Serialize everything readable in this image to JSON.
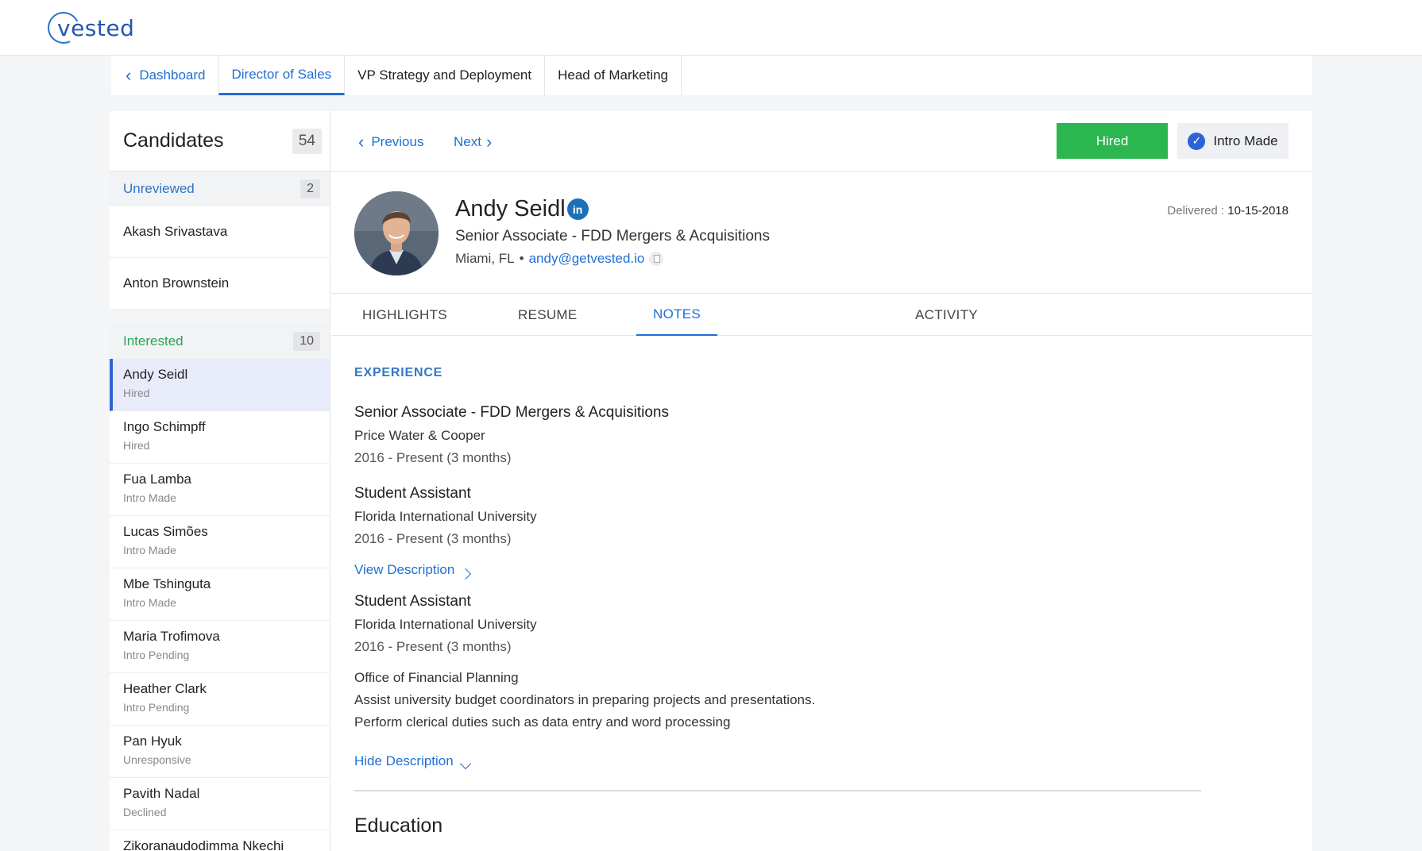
{
  "brand": {
    "logo_text": "vested"
  },
  "job_tabs": {
    "back_label": "Dashboard",
    "items": [
      "Director of Sales",
      "VP Strategy and Deployment",
      "Head of Marketing"
    ]
  },
  "sidebar": {
    "title": "Candidates",
    "total": "54",
    "groups": {
      "unreviewed": {
        "label": "Unreviewed",
        "count": "2",
        "items": [
          "Akash Srivastava",
          "Anton Brownstein"
        ]
      },
      "interested": {
        "label": "Interested",
        "count": "10",
        "items": [
          {
            "name": "Andy Seidl",
            "status": "Hired"
          },
          {
            "name": "Ingo Schimpff",
            "status": "Hired"
          },
          {
            "name": "Fua Lamba",
            "status": "Intro Made"
          },
          {
            "name": "Lucas Simões",
            "status": "Intro Made"
          },
          {
            "name": "Mbe Tshinguta",
            "status": "Intro Made"
          },
          {
            "name": "Maria Trofimova",
            "status": "Intro Pending"
          },
          {
            "name": "Heather Clark",
            "status": "Intro Pending"
          },
          {
            "name": "Pan Hyuk",
            "status": "Unresponsive"
          },
          {
            "name": "Pavith Nadal",
            "status": "Declined"
          },
          {
            "name": "Zikoranaudodimma Nkechi",
            "status": ""
          }
        ]
      }
    }
  },
  "nav": {
    "previous": "Previous",
    "next": "Next"
  },
  "actions": {
    "hired": "Hired",
    "intro_made": "Intro Made"
  },
  "profile": {
    "name": "Andy Seidl",
    "linkedin_glyph": "in",
    "title": "Senior Associate - FDD Mergers & Acquisitions",
    "location": "Miami, FL",
    "separator": "•",
    "email": "andy@getvested.io",
    "delivered_label": "Delivered :",
    "delivered_date": "10-15-2018"
  },
  "profile_tabs": [
    "HIGHLIGHTS",
    "RESUME",
    "NOTES",
    "ACTIVITY"
  ],
  "experience": {
    "label": "EXPERIENCE",
    "items": [
      {
        "title": "Senior Associate - FDD Mergers & Acquisitions",
        "org": "Price Water & Cooper",
        "dates": "2016 - Present (3 months)"
      },
      {
        "title": "Student Assistant",
        "org": "Florida International University",
        "dates": "2016 - Present (3 months)",
        "toggle": "View Description"
      },
      {
        "title": "Student Assistant",
        "org": "Florida International University",
        "dates": "2016 - Present (3 months)",
        "toggle": "Hide Description",
        "description": [
          "Office of Financial Planning",
          "Assist university budget coordinators in preparing projects and presentations.",
          "Perform clerical duties such as data entry and word processing"
        ]
      }
    ]
  },
  "education": {
    "label": "Education"
  },
  "colors": {
    "accent": "#1f6fd6",
    "hired": "#2bb64f",
    "interested": "#27a557",
    "selected_bg": "#e8ecfa"
  }
}
